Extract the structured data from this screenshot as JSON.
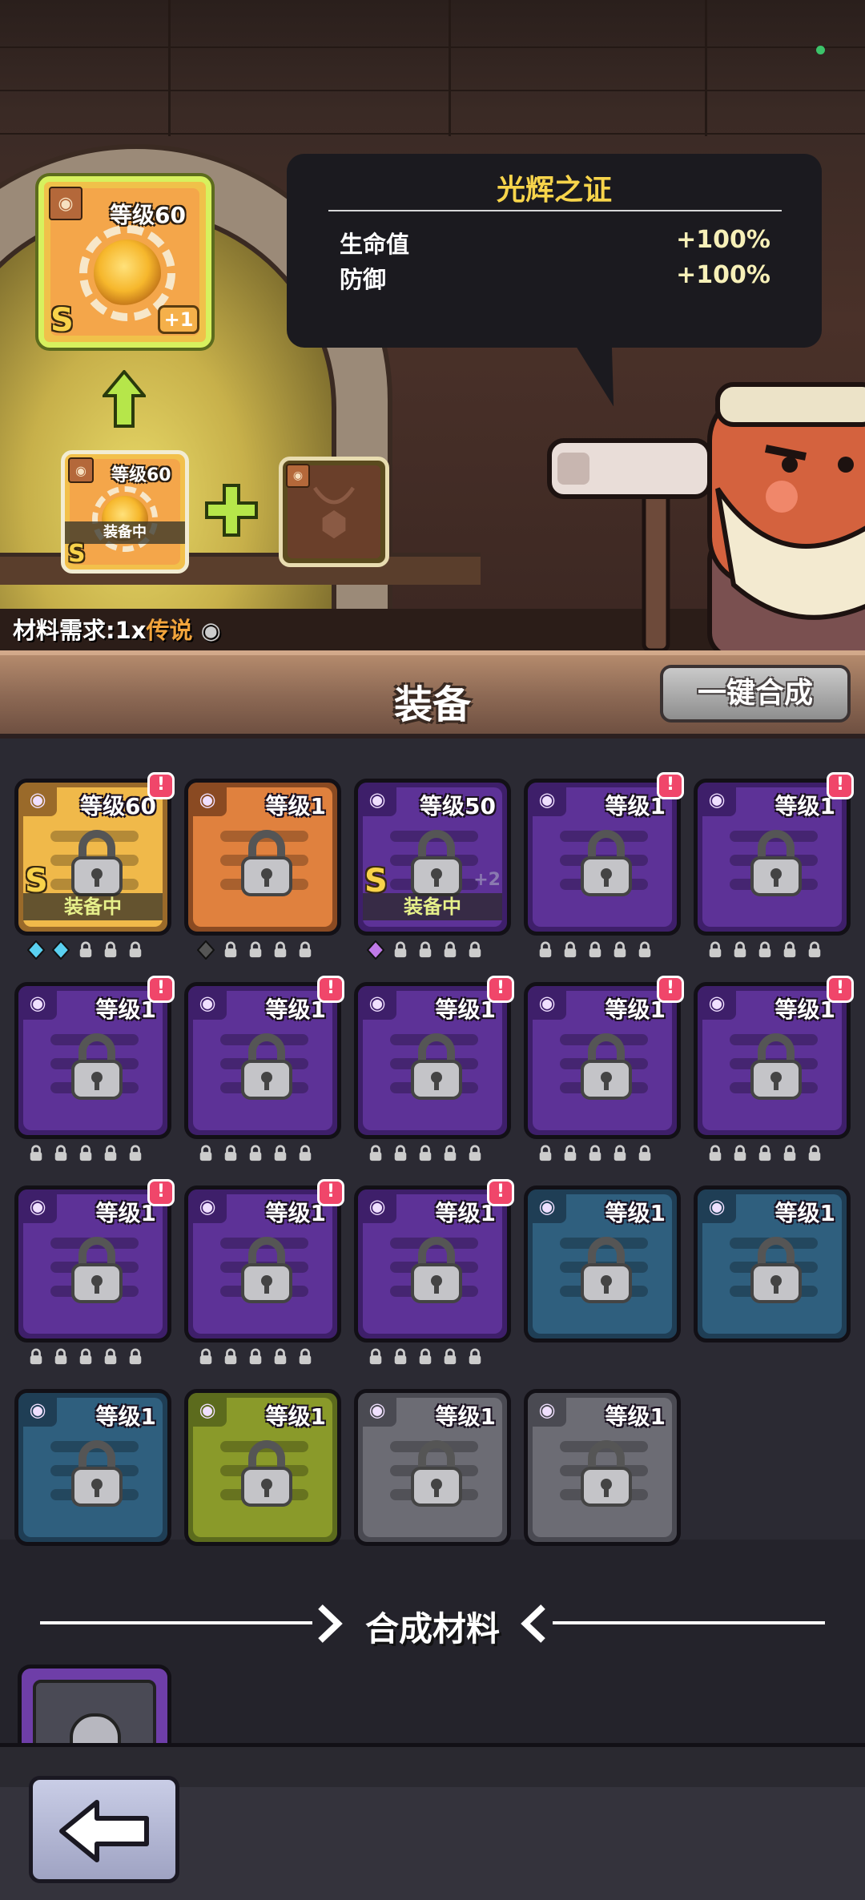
{
  "tooltip": {
    "title": "光辉之证",
    "stats": [
      {
        "name": "生命值",
        "value": "+100%"
      },
      {
        "name": "防御",
        "value": "+100%"
      }
    ]
  },
  "result_item": {
    "level": "等级60",
    "rank": "S",
    "plus": "+1"
  },
  "source_item": {
    "level": "等级60",
    "rank": "S",
    "status": "装备中"
  },
  "material_requirement": {
    "prefix": "材料需求:1x",
    "highlight": "传说"
  },
  "header": {
    "title": "装备",
    "auto_merge_label": "一键合成"
  },
  "inventory": [
    {
      "level": "等级60",
      "rarity": "gold",
      "alert": true,
      "rank": "S",
      "status": "装备中",
      "sockets": [
        "gem-blue",
        "gem-blue",
        "lock",
        "lock",
        "lock"
      ]
    },
    {
      "level": "等级1",
      "rarity": "orange",
      "alert": false,
      "sockets": [
        "gem-gray",
        "lock",
        "lock",
        "lock",
        "lock"
      ]
    },
    {
      "level": "等级50",
      "rarity": "purple",
      "alert": false,
      "rank": "S",
      "status": "装备中",
      "plus": "+2",
      "sockets": [
        "gem-purple",
        "lock",
        "lock",
        "lock",
        "lock"
      ]
    },
    {
      "level": "等级1",
      "rarity": "purple",
      "alert": true,
      "sockets": [
        "lock",
        "lock",
        "lock",
        "lock",
        "lock"
      ]
    },
    {
      "level": "等级1",
      "rarity": "purple",
      "alert": true,
      "sockets": [
        "lock",
        "lock",
        "lock",
        "lock",
        "lock"
      ]
    },
    {
      "level": "等级1",
      "rarity": "purple",
      "alert": true,
      "sockets": [
        "lock",
        "lock",
        "lock",
        "lock",
        "lock"
      ]
    },
    {
      "level": "等级1",
      "rarity": "purple",
      "alert": true,
      "sockets": [
        "lock",
        "lock",
        "lock",
        "lock",
        "lock"
      ]
    },
    {
      "level": "等级1",
      "rarity": "purple",
      "alert": true,
      "sockets": [
        "lock",
        "lock",
        "lock",
        "lock",
        "lock"
      ]
    },
    {
      "level": "等级1",
      "rarity": "purple",
      "alert": true,
      "sockets": [
        "lock",
        "lock",
        "lock",
        "lock",
        "lock"
      ]
    },
    {
      "level": "等级1",
      "rarity": "purple",
      "alert": true,
      "sockets": [
        "lock",
        "lock",
        "lock",
        "lock",
        "lock"
      ]
    },
    {
      "level": "等级1",
      "rarity": "purple",
      "alert": true,
      "sockets": [
        "lock",
        "lock",
        "lock",
        "lock",
        "lock"
      ]
    },
    {
      "level": "等级1",
      "rarity": "purple",
      "alert": true,
      "sockets": [
        "lock",
        "lock",
        "lock",
        "lock",
        "lock"
      ]
    },
    {
      "level": "等级1",
      "rarity": "purple",
      "alert": true,
      "sockets": [
        "lock",
        "lock",
        "lock",
        "lock",
        "lock"
      ]
    },
    {
      "level": "等级1",
      "rarity": "blue",
      "alert": false,
      "sockets": []
    },
    {
      "level": "等级1",
      "rarity": "blue",
      "alert": false,
      "sockets": []
    },
    {
      "level": "等级1",
      "rarity": "blue",
      "alert": false,
      "sockets": []
    },
    {
      "level": "等级1",
      "rarity": "green",
      "alert": false,
      "sockets": []
    },
    {
      "level": "等级1",
      "rarity": "gray",
      "alert": false,
      "sockets": []
    },
    {
      "level": "等级1",
      "rarity": "gray",
      "alert": false,
      "sockets": []
    }
  ],
  "material_section": {
    "title": "合成材料"
  },
  "colors": {
    "gold": "#f0b94a",
    "orange": "#e0813e",
    "purple": "#5d3297",
    "blue": "#2f5f7e",
    "green": "#8a9a2a",
    "gray": "#6c6c74",
    "accent_yellow": "#f7d44b",
    "legend_orange": "#f2a43c"
  }
}
